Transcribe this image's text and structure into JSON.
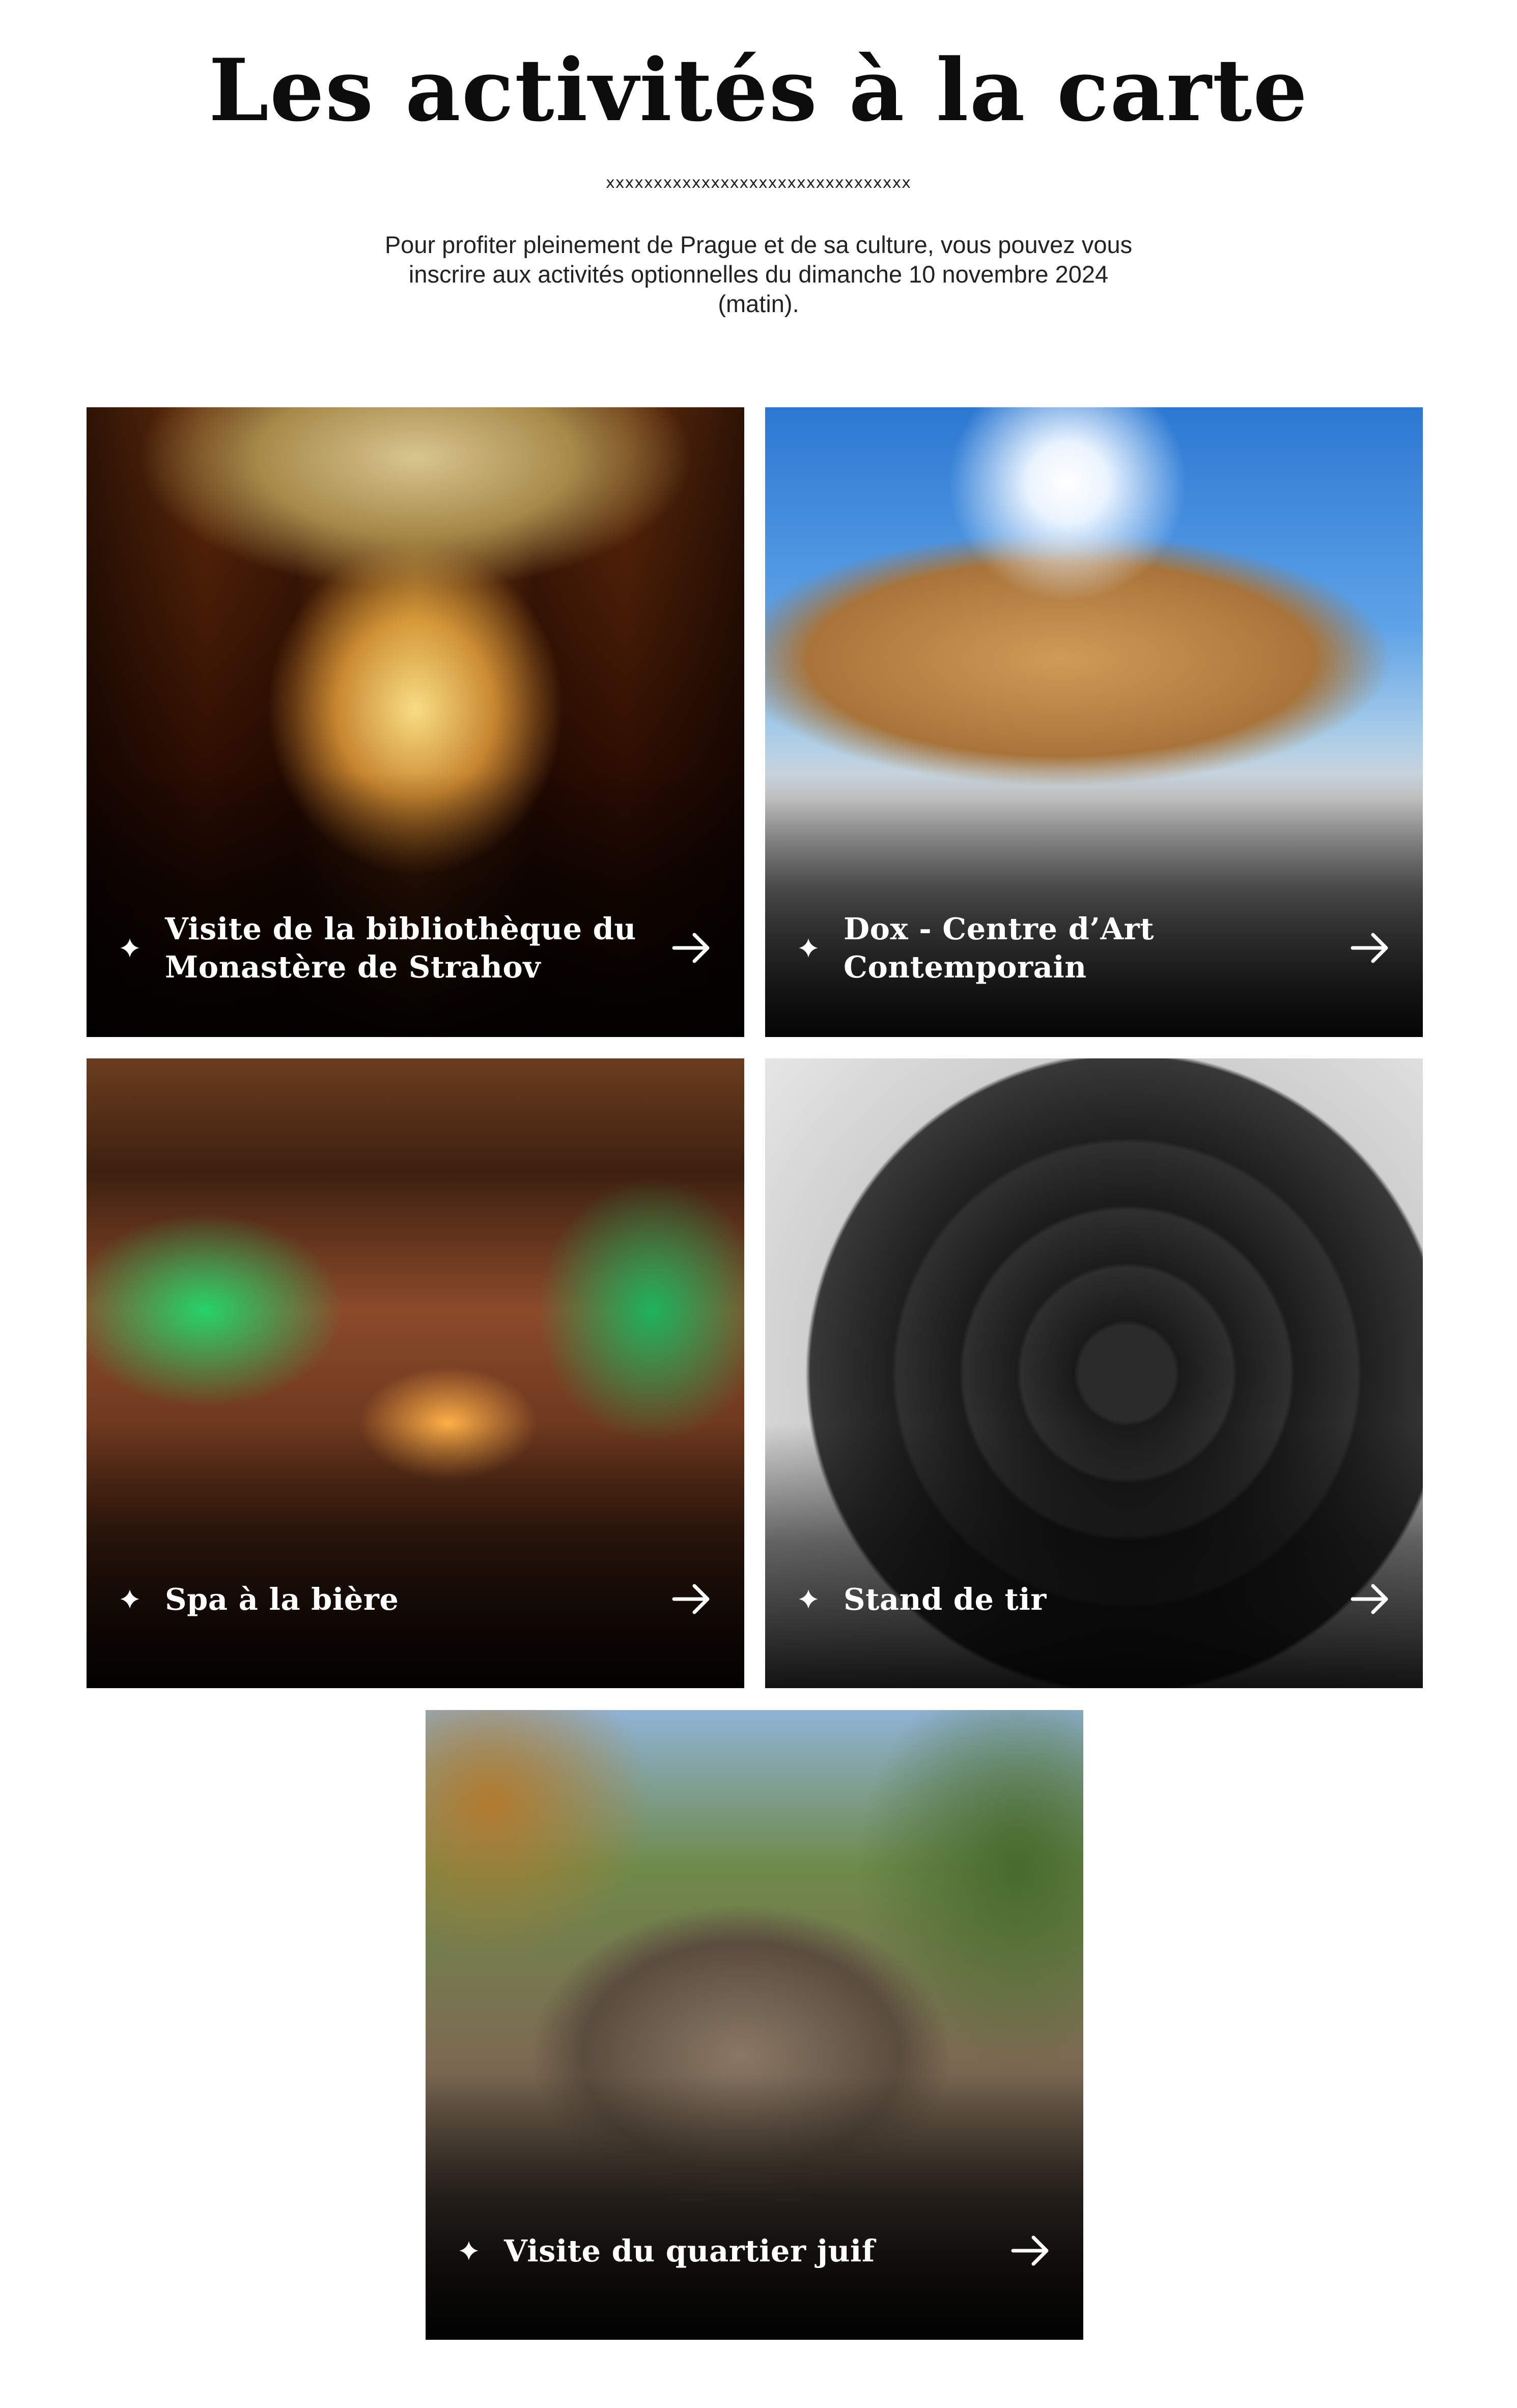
{
  "header": {
    "title": "Les activités à la carte",
    "divider": "xxxxxxxxxxxxxxxxxxxxxxxxxxxxxxxx",
    "intro": "Pour profiter pleinement de Prague et de sa culture, vous pouvez vous inscrire aux activités optionnelles du dimanche 10 novembre 2024 (matin)."
  },
  "colors": {
    "background": "#ffffff",
    "text": "#111111",
    "card_text": "#ffffff"
  },
  "activities": [
    {
      "label": "Visite de la bibliothèque du Monastère de Strahov",
      "icon_bullet": "diamond-icon",
      "icon_link": "arrow-right-icon"
    },
    {
      "label": "Dox - Centre d’Art Contemporain",
      "icon_bullet": "diamond-icon",
      "icon_link": "arrow-right-icon"
    },
    {
      "label": "Spa à la bière",
      "icon_bullet": "diamond-icon",
      "icon_link": "arrow-right-icon"
    },
    {
      "label": "Stand de tir",
      "icon_bullet": "diamond-icon",
      "icon_link": "arrow-right-icon"
    },
    {
      "label": "Visite du quartier juif",
      "icon_bullet": "diamond-icon",
      "icon_link": "arrow-right-icon"
    }
  ]
}
